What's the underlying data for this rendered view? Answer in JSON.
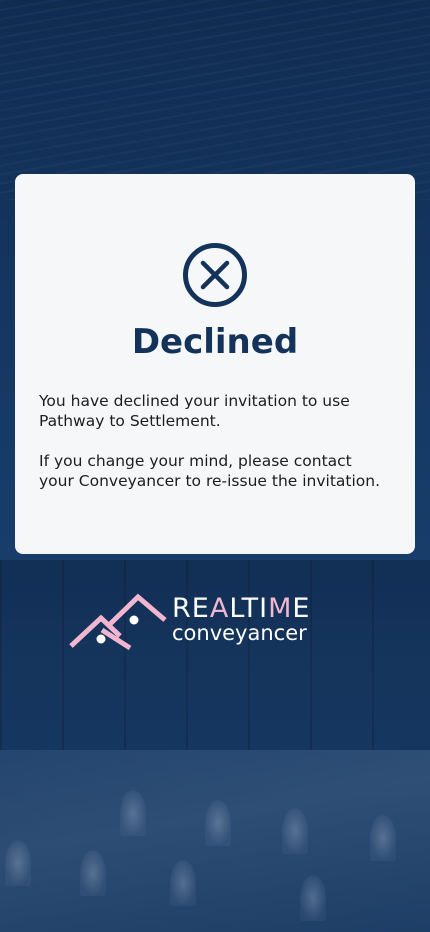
{
  "modal": {
    "icon": "circle-x-icon",
    "title": "Declined",
    "message_line1": "You have declined your invitation to use Pathway to Settlement.",
    "message_line2": "If you change your mind, please contact your Conveyancer to re-issue the invitation."
  },
  "logo": {
    "word_part1": "RE",
    "word_part2": "A",
    "word_part3": "LTI",
    "word_part4": "M",
    "word_part5": "E",
    "subtitle": "conveyancer"
  },
  "colors": {
    "primary": "#14335a",
    "card": "#f6f7f8",
    "logo_accent": "#f2b6d0"
  }
}
